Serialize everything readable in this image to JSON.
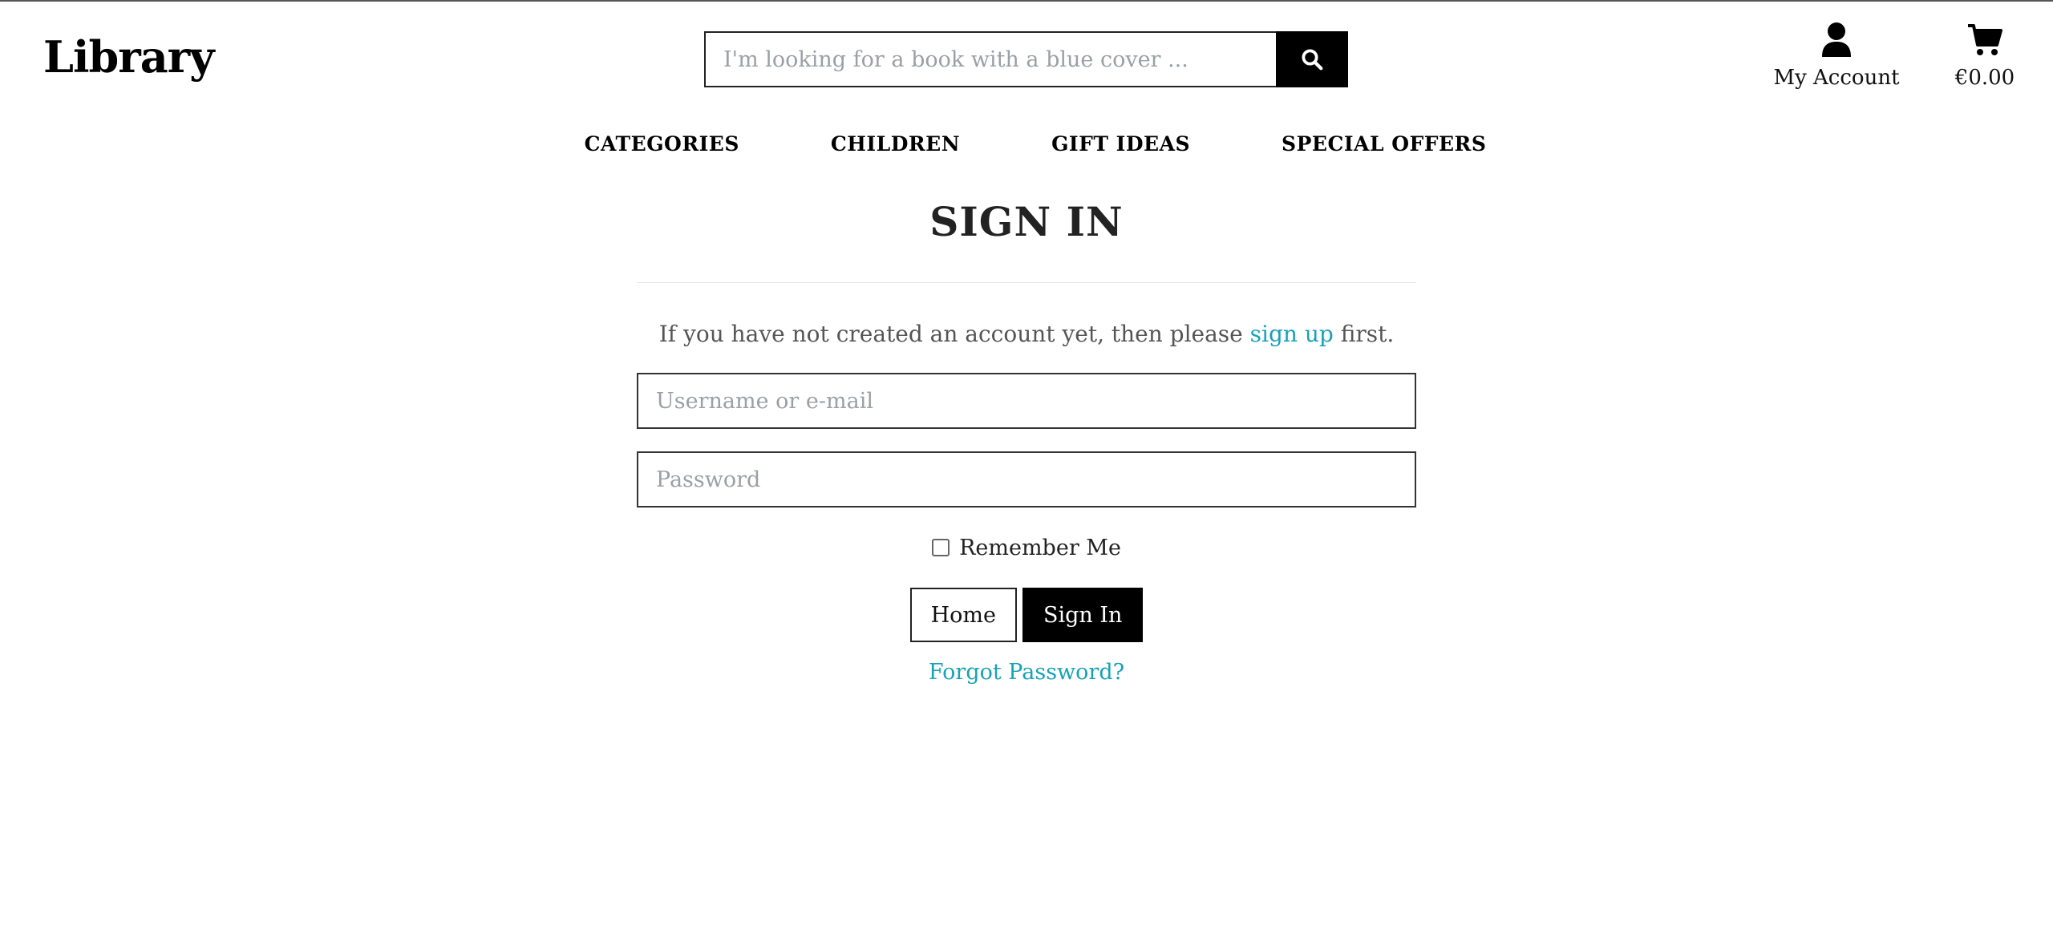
{
  "brand": {
    "logo_text": "Library"
  },
  "search": {
    "placeholder": "I'm looking for a book with a blue cover ..."
  },
  "account": {
    "label": "My Account"
  },
  "cart": {
    "total": "€0.00"
  },
  "nav": {
    "items": [
      {
        "label": "Categories"
      },
      {
        "label": "Children"
      },
      {
        "label": "Gift Ideas"
      },
      {
        "label": "Special Offers"
      }
    ]
  },
  "signin": {
    "title": "SIGN IN",
    "note_before": "If you have not created an account yet, then please ",
    "note_link": "sign up",
    "note_after": " first.",
    "username_placeholder": "Username or e-mail",
    "password_placeholder": "Password",
    "remember_label": "Remember Me",
    "home_button": "Home",
    "signin_button": "Sign In",
    "forgot_link": "Forgot Password?"
  },
  "colors": {
    "link": "#17a2b8",
    "primary_button": "#000000"
  },
  "icons": {
    "search": "search-icon",
    "account": "user-icon",
    "cart": "cart-icon"
  }
}
